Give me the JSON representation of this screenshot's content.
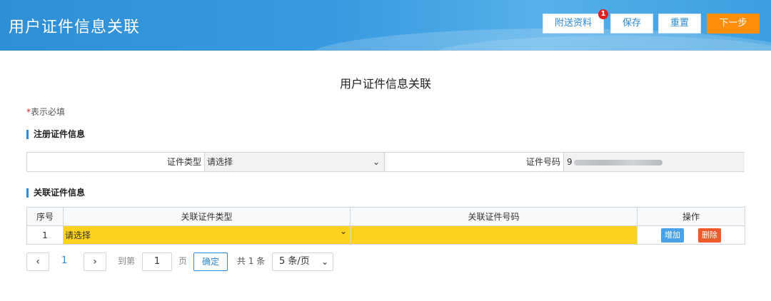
{
  "header": {
    "title": "用户证件信息关联",
    "buttons": {
      "attach": "附送资料",
      "save": "保存",
      "reset": "重置",
      "next": "下一步"
    },
    "attach_badge": "1",
    "colors": {
      "primary": "#2c8ad6",
      "next_button": "#ff8f0a",
      "badge": "#e02020"
    }
  },
  "page_title": "用户证件信息关联",
  "required_note": {
    "star": "*",
    "text": "表示必填"
  },
  "registered_section": {
    "title": "注册证件信息",
    "type_label": "证件类型",
    "type_value": "请选择",
    "number_label": "证件号码",
    "number_value_visible": "9"
  },
  "linked_section": {
    "title": "关联证件信息",
    "columns": [
      "序号",
      "关联证件类型",
      "关联证件号码",
      "操作"
    ],
    "rows": [
      {
        "index": "1",
        "type_value": "请选择",
        "number_value": "",
        "add_label": "增加",
        "delete_label": "删除"
      }
    ],
    "highlight_color": "#ffd21f"
  },
  "pagination": {
    "prev_icon": "‹",
    "current_page": "1",
    "next_icon": "›",
    "goto_label": "到第",
    "goto_value": "1",
    "page_label": "页",
    "confirm_label": "确定",
    "total_text": "共 1 条",
    "page_size": "5 条/页"
  }
}
